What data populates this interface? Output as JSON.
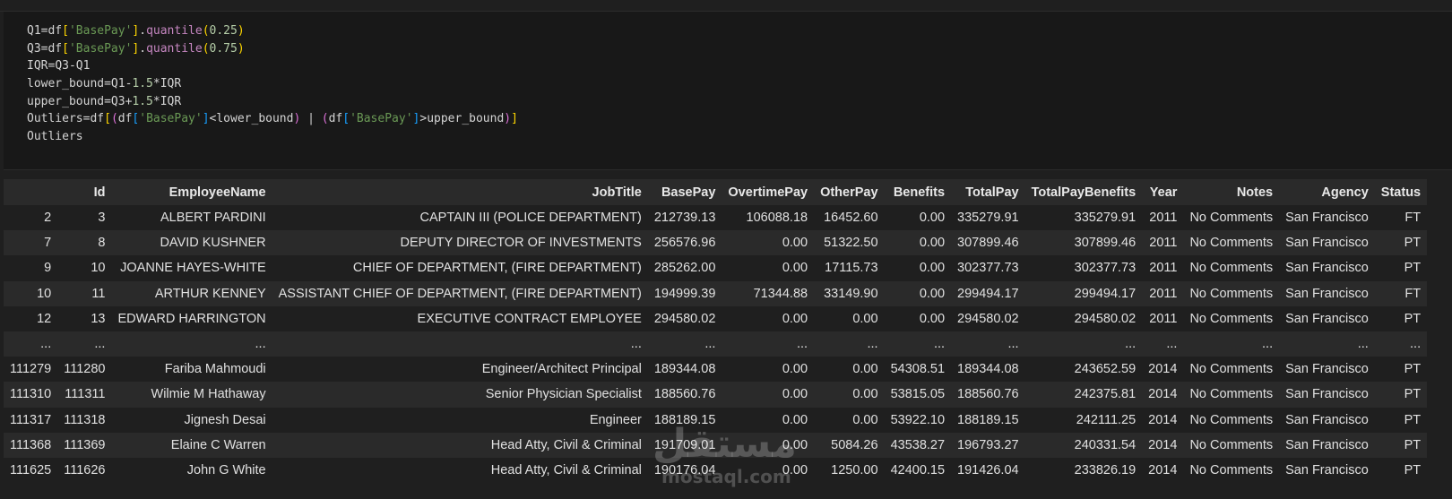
{
  "code_cell": {
    "lines": [
      [
        {
          "t": "Q1",
          "c": "tk-var"
        },
        {
          "t": "=",
          "c": "tk-op"
        },
        {
          "t": "df",
          "c": "tk-var"
        },
        {
          "t": "[",
          "c": "tk-b1"
        },
        {
          "t": "'BasePay'",
          "c": "tk-str"
        },
        {
          "t": "]",
          "c": "tk-b1"
        },
        {
          "t": ".",
          "c": "tk-op"
        },
        {
          "t": "quantile",
          "c": "tk-fn"
        },
        {
          "t": "(",
          "c": "tk-b1"
        },
        {
          "t": "0.25",
          "c": "tk-num"
        },
        {
          "t": ")",
          "c": "tk-b1"
        }
      ],
      [
        {
          "t": "Q3",
          "c": "tk-var"
        },
        {
          "t": "=",
          "c": "tk-op"
        },
        {
          "t": "df",
          "c": "tk-var"
        },
        {
          "t": "[",
          "c": "tk-b1"
        },
        {
          "t": "'BasePay'",
          "c": "tk-str"
        },
        {
          "t": "]",
          "c": "tk-b1"
        },
        {
          "t": ".",
          "c": "tk-op"
        },
        {
          "t": "quantile",
          "c": "tk-fn"
        },
        {
          "t": "(",
          "c": "tk-b1"
        },
        {
          "t": "0.75",
          "c": "tk-num"
        },
        {
          "t": ")",
          "c": "tk-b1"
        }
      ],
      [
        {
          "t": "IQR",
          "c": "tk-var"
        },
        {
          "t": "=",
          "c": "tk-op"
        },
        {
          "t": "Q3",
          "c": "tk-var"
        },
        {
          "t": "-",
          "c": "tk-op"
        },
        {
          "t": "Q1",
          "c": "tk-var"
        }
      ],
      [
        {
          "t": "lower_bound",
          "c": "tk-var"
        },
        {
          "t": "=",
          "c": "tk-op"
        },
        {
          "t": "Q1",
          "c": "tk-var"
        },
        {
          "t": "-",
          "c": "tk-op"
        },
        {
          "t": "1.5",
          "c": "tk-num"
        },
        {
          "t": "*",
          "c": "tk-op"
        },
        {
          "t": "IQR",
          "c": "tk-var"
        }
      ],
      [
        {
          "t": "upper_bound",
          "c": "tk-var"
        },
        {
          "t": "=",
          "c": "tk-op"
        },
        {
          "t": "Q3",
          "c": "tk-var"
        },
        {
          "t": "+",
          "c": "tk-op"
        },
        {
          "t": "1.5",
          "c": "tk-num"
        },
        {
          "t": "*",
          "c": "tk-op"
        },
        {
          "t": "IQR",
          "c": "tk-var"
        }
      ],
      [
        {
          "t": "Outliers",
          "c": "tk-var"
        },
        {
          "t": "=",
          "c": "tk-op"
        },
        {
          "t": "df",
          "c": "tk-var"
        },
        {
          "t": "[",
          "c": "tk-b1"
        },
        {
          "t": "(",
          "c": "tk-b2"
        },
        {
          "t": "df",
          "c": "tk-var"
        },
        {
          "t": "[",
          "c": "tk-b3"
        },
        {
          "t": "'BasePay'",
          "c": "tk-str"
        },
        {
          "t": "]",
          "c": "tk-b3"
        },
        {
          "t": "<",
          "c": "tk-op"
        },
        {
          "t": "lower_bound",
          "c": "tk-var"
        },
        {
          "t": ")",
          "c": "tk-b2"
        },
        {
          "t": " | ",
          "c": "tk-op"
        },
        {
          "t": "(",
          "c": "tk-b2"
        },
        {
          "t": "df",
          "c": "tk-var"
        },
        {
          "t": "[",
          "c": "tk-b3"
        },
        {
          "t": "'BasePay'",
          "c": "tk-str"
        },
        {
          "t": "]",
          "c": "tk-b3"
        },
        {
          "t": ">",
          "c": "tk-op"
        },
        {
          "t": "upper_bound",
          "c": "tk-var"
        },
        {
          "t": ")",
          "c": "tk-b2"
        },
        {
          "t": "]",
          "c": "tk-b1"
        }
      ],
      [
        {
          "t": "Outliers",
          "c": "tk-var"
        }
      ]
    ]
  },
  "dataframe": {
    "columns": [
      "",
      "Id",
      "EmployeeName",
      "JobTitle",
      "BasePay",
      "OvertimePay",
      "OtherPay",
      "Benefits",
      "TotalPay",
      "TotalPayBenefits",
      "Year",
      "Notes",
      "Agency",
      "Status"
    ],
    "rows": [
      [
        "2",
        "3",
        "ALBERT PARDINI",
        "CAPTAIN III (POLICE DEPARTMENT)",
        "212739.13",
        "106088.18",
        "16452.60",
        "0.00",
        "335279.91",
        "335279.91",
        "2011",
        "No Comments",
        "San Francisco",
        "FT"
      ],
      [
        "7",
        "8",
        "DAVID KUSHNER",
        "DEPUTY DIRECTOR OF INVESTMENTS",
        "256576.96",
        "0.00",
        "51322.50",
        "0.00",
        "307899.46",
        "307899.46",
        "2011",
        "No Comments",
        "San Francisco",
        "PT"
      ],
      [
        "9",
        "10",
        "JOANNE HAYES-WHITE",
        "CHIEF OF DEPARTMENT, (FIRE DEPARTMENT)",
        "285262.00",
        "0.00",
        "17115.73",
        "0.00",
        "302377.73",
        "302377.73",
        "2011",
        "No Comments",
        "San Francisco",
        "PT"
      ],
      [
        "10",
        "11",
        "ARTHUR KENNEY",
        "ASSISTANT CHIEF OF DEPARTMENT, (FIRE DEPARTMENT)",
        "194999.39",
        "71344.88",
        "33149.90",
        "0.00",
        "299494.17",
        "299494.17",
        "2011",
        "No Comments",
        "San Francisco",
        "FT"
      ],
      [
        "12",
        "13",
        "EDWARD HARRINGTON",
        "EXECUTIVE CONTRACT EMPLOYEE",
        "294580.02",
        "0.00",
        "0.00",
        "0.00",
        "294580.02",
        "294580.02",
        "2011",
        "No Comments",
        "San Francisco",
        "PT"
      ],
      [
        "...",
        "...",
        "...",
        "...",
        "...",
        "...",
        "...",
        "...",
        "...",
        "...",
        "...",
        "...",
        "...",
        "..."
      ],
      [
        "111279",
        "111280",
        "Fariba Mahmoudi",
        "Engineer/Architect Principal",
        "189344.08",
        "0.00",
        "0.00",
        "54308.51",
        "189344.08",
        "243652.59",
        "2014",
        "No Comments",
        "San Francisco",
        "PT"
      ],
      [
        "111310",
        "111311",
        "Wilmie M Hathaway",
        "Senior Physician Specialist",
        "188560.76",
        "0.00",
        "0.00",
        "53815.05",
        "188560.76",
        "242375.81",
        "2014",
        "No Comments",
        "San Francisco",
        "PT"
      ],
      [
        "111317",
        "111318",
        "Jignesh Desai",
        "Engineer",
        "188189.15",
        "0.00",
        "0.00",
        "53922.10",
        "188189.15",
        "242111.25",
        "2014",
        "No Comments",
        "San Francisco",
        "PT"
      ],
      [
        "111368",
        "111369",
        "Elaine C Warren",
        "Head Atty, Civil & Criminal",
        "191709.01",
        "0.00",
        "5084.26",
        "43538.27",
        "196793.27",
        "240331.54",
        "2014",
        "No Comments",
        "San Francisco",
        "PT"
      ],
      [
        "111625",
        "111626",
        "John G White",
        "Head Atty, Civil & Criminal",
        "190176.04",
        "0.00",
        "1250.00",
        "42400.15",
        "191426.04",
        "233826.19",
        "2014",
        "No Comments",
        "San Francisco",
        "PT"
      ]
    ]
  },
  "watermark": {
    "arabic": "مستقل",
    "latin": "mostaql.com"
  }
}
